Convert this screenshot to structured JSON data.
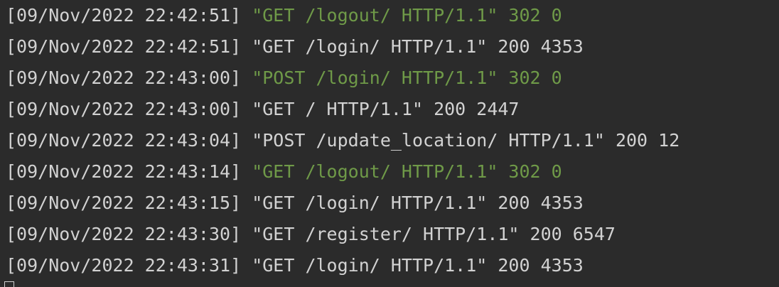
{
  "console": {
    "lines": [
      {
        "timestamp": "[09/Nov/2022 22:42:51]",
        "request": "\"GET /logout/ HTTP/1.1\" 302 0",
        "kind": "redirect"
      },
      {
        "timestamp": "[09/Nov/2022 22:42:51]",
        "request": "\"GET /login/ HTTP/1.1\" 200 4353",
        "kind": "ok"
      },
      {
        "timestamp": "[09/Nov/2022 22:43:00]",
        "request": "\"POST /login/ HTTP/1.1\" 302 0",
        "kind": "redirect"
      },
      {
        "timestamp": "[09/Nov/2022 22:43:00]",
        "request": "\"GET / HTTP/1.1\" 200 2447",
        "kind": "ok"
      },
      {
        "timestamp": "[09/Nov/2022 22:43:04]",
        "request": "\"POST /update_location/ HTTP/1.1\" 200 12",
        "kind": "ok"
      },
      {
        "timestamp": "[09/Nov/2022 22:43:14]",
        "request": "\"GET /logout/ HTTP/1.1\" 302 0",
        "kind": "redirect"
      },
      {
        "timestamp": "[09/Nov/2022 22:43:15]",
        "request": "\"GET /login/ HTTP/1.1\" 200 4353",
        "kind": "ok"
      },
      {
        "timestamp": "[09/Nov/2022 22:43:30]",
        "request": "\"GET /register/ HTTP/1.1\" 200 6547",
        "kind": "ok"
      },
      {
        "timestamp": "[09/Nov/2022 22:43:31]",
        "request": "\"GET /login/ HTTP/1.1\" 200 4353",
        "kind": "ok"
      }
    ],
    "colors": {
      "background": "#2b2b2b",
      "text": "#d2d2d2",
      "redirect": "#6f9a48"
    }
  }
}
